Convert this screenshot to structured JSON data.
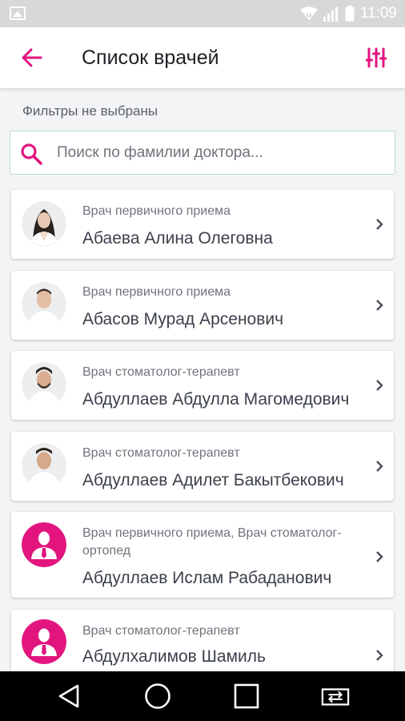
{
  "status_bar": {
    "time": "11:09",
    "icons": [
      "gallery-icon",
      "wifi-icon",
      "signal-icon",
      "battery-icon"
    ]
  },
  "app_bar": {
    "title": "Список врачей",
    "back_icon": "arrow-left-icon",
    "filter_icon": "sliders-icon"
  },
  "filters_label": "Фильтры не выбраны",
  "search": {
    "placeholder": "Поиск по фамилии доктора...",
    "value": "",
    "icon": "search-icon"
  },
  "doctors": [
    {
      "specialty": "Врач первичного приема",
      "name": "Абаева Алина Олеговна",
      "avatar": "photo-woman"
    },
    {
      "specialty": "Врач первичного приема",
      "name": "Абасов Мурад Арсенович",
      "avatar": "photo-man"
    },
    {
      "specialty": "Врач стоматолог-терапевт",
      "name": "Абдуллаев Абдулла Магомедович",
      "avatar": "photo-man"
    },
    {
      "specialty": "Врач стоматолог-терапевт",
      "name": "Абдуллаев Адилет Бакытбекович",
      "avatar": "photo-man"
    },
    {
      "specialty": "Врач первичного приема, Врач стоматолог-ортопед",
      "name": "Абдуллаев Ислам Рабаданович",
      "avatar": "placeholder"
    },
    {
      "specialty": "Врач стоматолог-терапевт",
      "name": "Абдулхалимов Шамиль",
      "avatar": "placeholder"
    }
  ],
  "nav_bar": {
    "icons": [
      "back-triangle-icon",
      "home-circle-icon",
      "recents-square-icon",
      "swap-apps-icon"
    ]
  },
  "colors": {
    "accent": "#e2157f",
    "text_primary": "#3b404b",
    "text_secondary": "#70747d",
    "search_border": "#b6dcd0"
  }
}
